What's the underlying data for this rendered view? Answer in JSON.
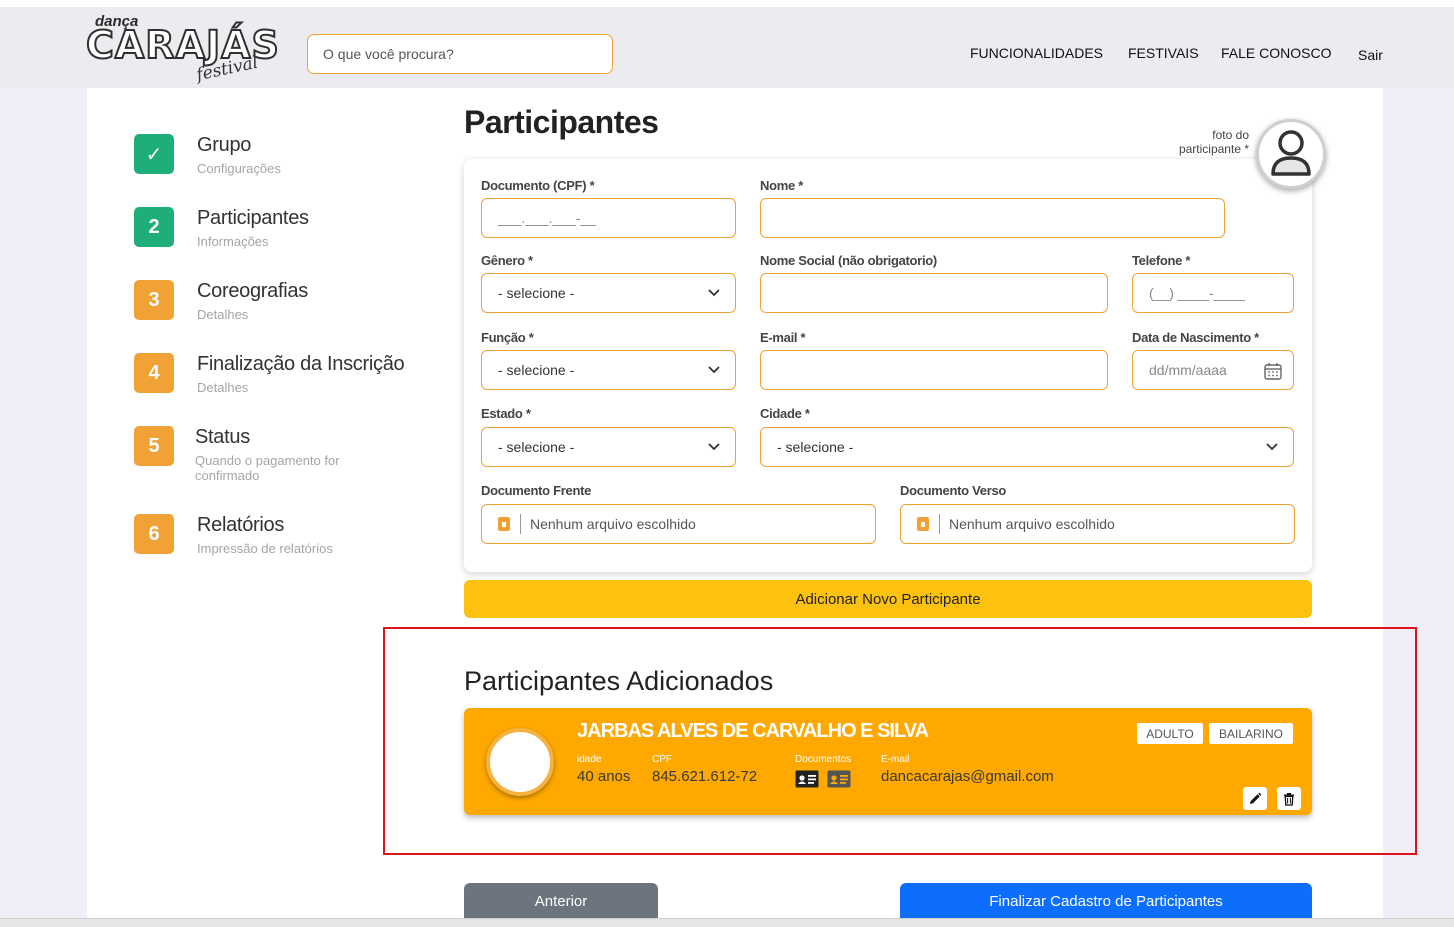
{
  "header": {
    "logo": {
      "top": "dança",
      "main": "CARAJÁS",
      "script": "festival"
    },
    "search_placeholder": "O que você procura?",
    "nav": [
      "FUNCIONALIDADES",
      "FESTIVAIS",
      "FALE CONOSCO",
      "Sair"
    ]
  },
  "steps": [
    {
      "badge": "✓",
      "title": "Grupo",
      "sub": "Configurações",
      "state": "done"
    },
    {
      "badge": "2",
      "title": "Participantes",
      "sub": "Informações",
      "state": "active"
    },
    {
      "badge": "3",
      "title": "Coreografias",
      "sub": "Detalhes",
      "state": "pending"
    },
    {
      "badge": "4",
      "title": "Finalização da Inscrição",
      "sub": "Detalhes",
      "state": "pending"
    },
    {
      "badge": "5",
      "title": "Status",
      "sub": "Quando o pagamento for confirmado",
      "state": "pending"
    },
    {
      "badge": "6",
      "title": "Relatórios",
      "sub": "Impressão de relatórios",
      "state": "pending"
    }
  ],
  "page_title": "Participantes",
  "photo_label": "foto do participante *",
  "form": {
    "cpf": {
      "label": "Documento (CPF) *",
      "placeholder": "___.___.___-__"
    },
    "nome": {
      "label": "Nome *",
      "value": ""
    },
    "genero": {
      "label": "Gênero *",
      "value": "- selecione -"
    },
    "nome_social": {
      "label": "Nome Social (não obrigatorio)",
      "value": ""
    },
    "telefone": {
      "label": "Telefone *",
      "placeholder": "(__) ____-____"
    },
    "funcao": {
      "label": "Função *",
      "value": "- selecione -"
    },
    "email": {
      "label": "E-mail *",
      "value": ""
    },
    "nascimento": {
      "label": "Data de Nascimento *",
      "placeholder": "dd/mm/aaaa"
    },
    "estado": {
      "label": "Estado *",
      "value": "- selecione -"
    },
    "cidade": {
      "label": "Cidade *",
      "value": "- selecione -"
    },
    "doc_frente": {
      "label": "Documento Frente",
      "value": "Nenhum arquivo escolhido"
    },
    "doc_verso": {
      "label": "Documento Verso",
      "value": "Nenhum arquivo escolhido"
    }
  },
  "add_button": "Adicionar Novo Participante",
  "added_title": "Participantes Adicionados",
  "participant": {
    "name": "JARBAS ALVES DE CARVALHO E SILVA",
    "tags": [
      "ADULTO",
      "BAILARINO"
    ],
    "idade_label": "idade",
    "idade": "40 anos",
    "cpf_label": "CPF",
    "cpf": "845.621.612-72",
    "docs_label": "Documentos",
    "email_label": "E-mail",
    "email": "dancacarajas@gmail.com"
  },
  "buttons": {
    "prev": "Anterior",
    "finish": "Finalizar Cadastro de Participantes"
  },
  "colors": {
    "accent": "#f0a236",
    "card": "#fea800",
    "add": "#fdc10f",
    "primary": "#0d6efd",
    "secondary": "#6c757d",
    "success": "#1fae7a",
    "highlight": "#d9141b"
  }
}
